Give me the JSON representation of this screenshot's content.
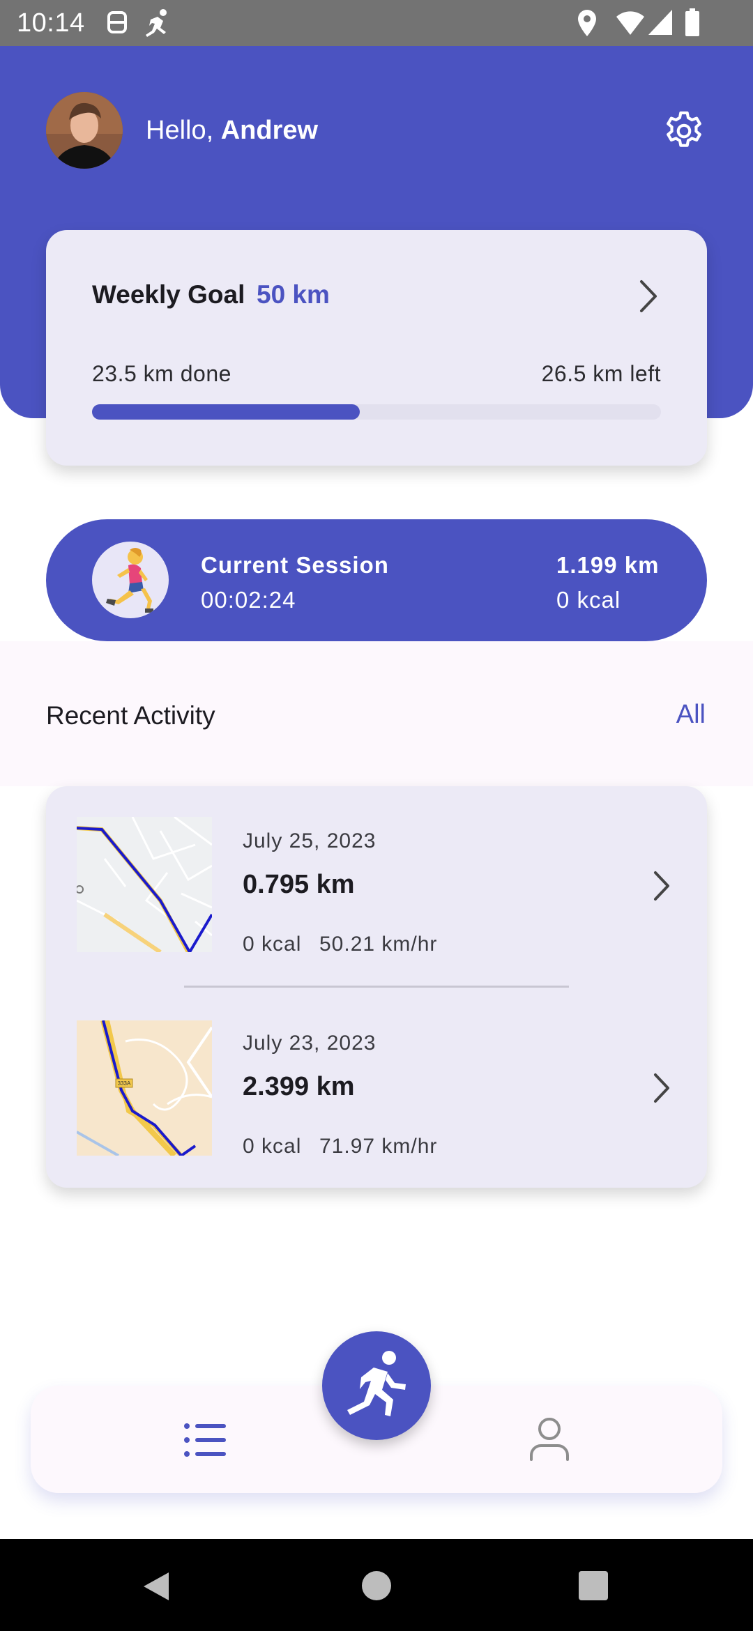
{
  "status_bar": {
    "time": "10:14",
    "icons": [
      "data-saver-icon",
      "running-figure-icon",
      "location-icon",
      "wifi-icon",
      "signal-icon",
      "battery-icon"
    ]
  },
  "header": {
    "greeting_prefix": "Hello, ",
    "user_name": "Andrew",
    "settings_icon": "gear-icon",
    "background_color": "#4b53c1"
  },
  "weekly_goal": {
    "title": "Weekly Goal",
    "goal_value": "50 km",
    "done_text": "23.5 km done",
    "left_text": "26.5 km left",
    "progress_fraction": 0.47
  },
  "current_session": {
    "title": "Current Session",
    "duration": "00:02:24",
    "distance": "1.199 km",
    "calories": "0 kcal",
    "icon": "woman-running-emoji"
  },
  "recent_activity": {
    "title": "Recent Activity",
    "all_label": "All",
    "items": [
      {
        "date": "July 25, 2023",
        "distance": "0.795 km",
        "calories": "0 kcal",
        "speed": "50.21 km/hr",
        "map_icon": "route-map-thumbnail"
      },
      {
        "date": "July 23, 2023",
        "distance": "2.399 km",
        "calories": "0 kcal",
        "speed": "71.97 km/hr",
        "map_icon": "route-map-thumbnail",
        "map_label": "333A"
      }
    ]
  },
  "bottom_nav": {
    "items": [
      "list-icon",
      "profile-icon"
    ],
    "fab_icon": "run-icon",
    "accent": "#4b53c1"
  }
}
